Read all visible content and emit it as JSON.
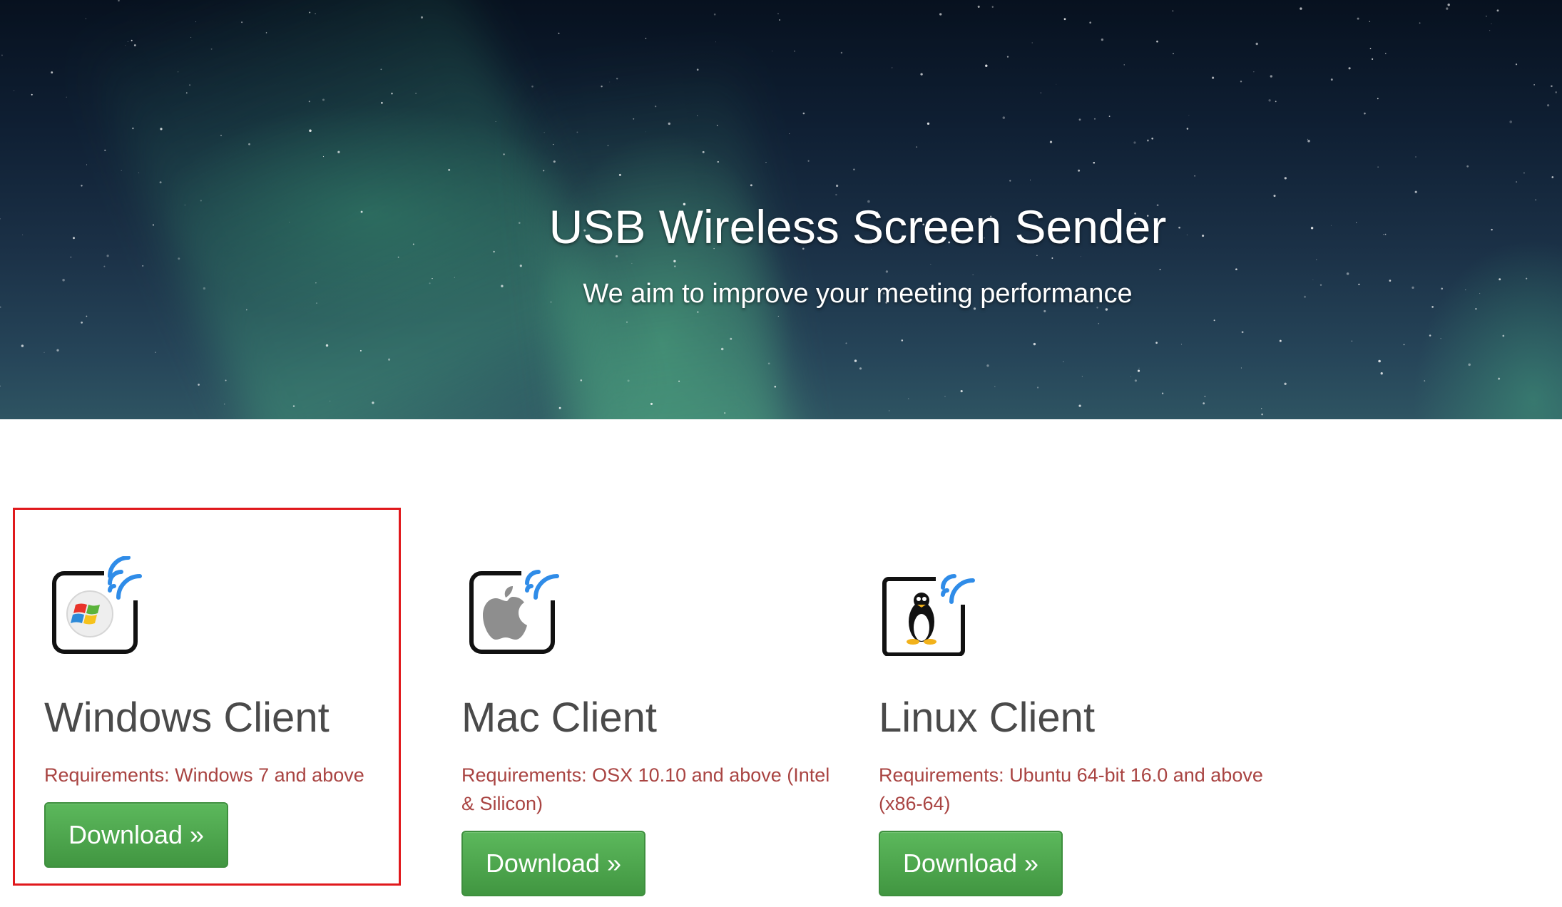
{
  "hero": {
    "title": "USB Wireless Screen Sender",
    "subtitle": "We aim to improve your meeting performance"
  },
  "clients": [
    {
      "icon": "windows-wireless-icon",
      "title": "Windows Client",
      "requirements": "Requirements: Windows 7 and above",
      "download_label": "Download »"
    },
    {
      "icon": "mac-wireless-icon",
      "title": "Mac Client",
      "requirements": "Requirements: OSX 10.10 and above (Intel & Silicon)",
      "download_label": "Download »"
    },
    {
      "icon": "linux-wireless-icon",
      "title": "Linux Client",
      "requirements": "Requirements: Ubuntu 64-bit 16.0 and above (x86-64)",
      "download_label": "Download »"
    }
  ],
  "colors": {
    "button_green": "#5cb85c",
    "requirements_red": "#a94442",
    "highlight_red": "#e0191c",
    "wifi_blue": "#2f8ce8"
  }
}
